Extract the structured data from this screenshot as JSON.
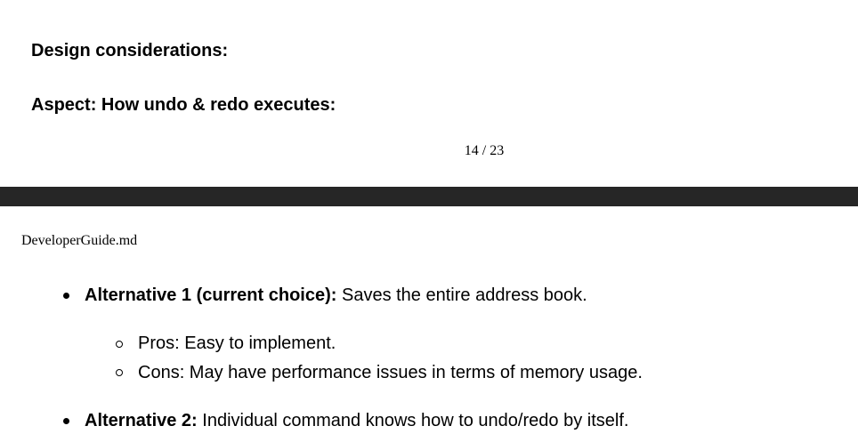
{
  "page_one": {
    "heading_design": "Design considerations:",
    "heading_aspect": "Aspect: How undo & redo executes:",
    "page_number": "14 / 23"
  },
  "page_two": {
    "running_header": "DeveloperGuide.md",
    "alternative_1": {
      "label": "Alternative 1 (current choice):",
      "text": " Saves the entire address book.",
      "pros": "Pros: Easy to implement.",
      "cons": "Cons: May have performance issues in terms of memory usage."
    },
    "alternative_2": {
      "label": "Alternative 2:",
      "text": " Individual command knows how to undo/redo by itself."
    }
  }
}
